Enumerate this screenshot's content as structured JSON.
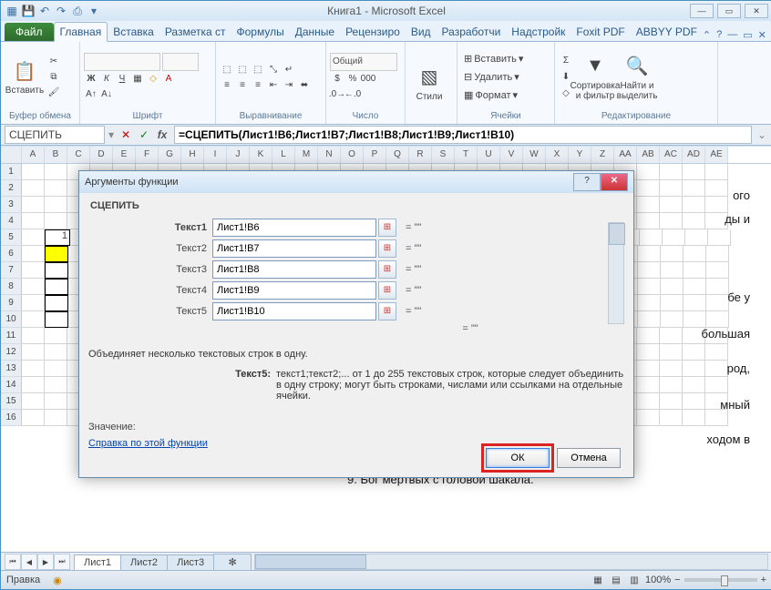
{
  "title": "Книга1  -  Microsoft Excel",
  "qat": [
    "save",
    "undo",
    "redo",
    "print",
    "more"
  ],
  "tabs": {
    "file": "Файл",
    "items": [
      "Главная",
      "Вставка",
      "Разметка ст",
      "Формулы",
      "Данные",
      "Рецензиро",
      "Вид",
      "Разработчи",
      "Надстройк",
      "Foxit PDF",
      "ABBYY PDF"
    ],
    "active": 0
  },
  "ribbon": {
    "clipboard": {
      "label": "Буфер обмена",
      "paste": "Вставить"
    },
    "font": {
      "label": "Шрифт"
    },
    "align": {
      "label": "Выравнивание"
    },
    "number": {
      "label": "Число",
      "format": "Общий"
    },
    "styles": {
      "label": "Стили",
      "btn": "Стили"
    },
    "cells": {
      "label": "Ячейки",
      "insert": "Вставить",
      "delete": "Удалить",
      "format": "Формат"
    },
    "editing": {
      "label": "Редактирование",
      "sort": "Сортировка и фильтр",
      "find": "Найти и выделить"
    }
  },
  "namebox": "СЦЕПИТЬ",
  "formula": "=СЦЕПИТЬ(Лист1!B6;Лист1!B7;Лист1!B8;Лист1!B9;Лист1!B10)",
  "columns": [
    "",
    "A",
    "B",
    "C",
    "D",
    "E",
    "F",
    "G",
    "H",
    "I",
    "J",
    "K",
    "L",
    "M",
    "N",
    "O",
    "P",
    "Q",
    "R",
    "S",
    "T",
    "U",
    "V",
    "W",
    "X",
    "Y",
    "Z",
    "AA",
    "AB",
    "AC",
    "AD",
    "AE"
  ],
  "rows_visible": 16,
  "row5_b": "1",
  "sheets": [
    "Лист1",
    "Лист2",
    "Лист3"
  ],
  "status": "Правка",
  "zoom": "100%",
  "dialog": {
    "title": "Аргументы функции",
    "fn": "СЦЕПИТЬ",
    "args": [
      {
        "label": "Текст1",
        "value": "Лист1!B6",
        "res": "\"\"",
        "bold": true
      },
      {
        "label": "Текст2",
        "value": "Лист1!B7",
        "res": "\"\""
      },
      {
        "label": "Текст3",
        "value": "Лист1!B8",
        "res": "\"\""
      },
      {
        "label": "Текст4",
        "value": "Лист1!B9",
        "res": "\"\""
      },
      {
        "label": "Текст5",
        "value": "Лист1!B10",
        "res": "\"\""
      }
    ],
    "result_eq": "=  \"\"",
    "desc1": "Объединяет несколько текстовых строк в одну.",
    "arg_name": "Текст5:",
    "arg_desc": "текст1;текст2;... от 1 до 255 текстовых строк, которые следует объединить в одну строку; могут быть строками, числами или ссылками на отдельные ячейки.",
    "value_label": "Значение:",
    "help": "Справка по этой функции",
    "ok": "ОК",
    "cancel": "Отмена"
  },
  "bg_text": {
    "l1": "ого",
    "l2": "ды и",
    "l3": "бе у",
    "l4": "большая",
    "l5": "род,",
    "l6": "мный",
    "l7": "ходом в",
    "l9": "9. Бог мертвых с головой шакала."
  }
}
